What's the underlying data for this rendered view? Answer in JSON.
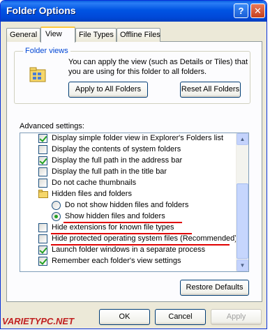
{
  "window": {
    "title": "Folder Options",
    "help_glyph": "?",
    "close_glyph": "✕"
  },
  "tabs": [
    "General",
    "View",
    "File Types",
    "Offline Files"
  ],
  "folder_views": {
    "label": "Folder views",
    "description": "You can apply the view (such as Details or Tiles) that you are using for this folder to all folders.",
    "apply_button": "Apply to All Folders",
    "reset_button": "Reset All Folders"
  },
  "advanced": {
    "label": "Advanced settings:",
    "items": [
      {
        "type": "checkbox",
        "checked": true,
        "label": "Display simple folder view in Explorer's Folders list"
      },
      {
        "type": "checkbox",
        "checked": false,
        "label": "Display the contents of system folders"
      },
      {
        "type": "checkbox",
        "checked": true,
        "label": "Display the full path in the address bar"
      },
      {
        "type": "checkbox",
        "checked": false,
        "label": "Display the full path in the title bar"
      },
      {
        "type": "checkbox",
        "checked": false,
        "label": "Do not cache thumbnails"
      },
      {
        "type": "folder",
        "label": "Hidden files and folders"
      },
      {
        "type": "radio",
        "checked": false,
        "label": "Do not show hidden files and folders"
      },
      {
        "type": "radio",
        "checked": true,
        "label": "Show hidden files and folders"
      },
      {
        "type": "checkbox",
        "checked": false,
        "label": "Hide extensions for known file types"
      },
      {
        "type": "checkbox",
        "checked": false,
        "label": "Hide protected operating system files (Recommended)"
      },
      {
        "type": "checkbox",
        "checked": true,
        "label": "Launch folder windows in a separate process"
      },
      {
        "type": "checkbox",
        "checked": true,
        "label": "Remember each folder's view settings"
      }
    ],
    "restore_button": "Restore Defaults"
  },
  "footer": {
    "ok": "OK",
    "cancel": "Cancel",
    "apply": "Apply"
  },
  "watermark": "VARIETYPC.NET",
  "colors": {
    "title_bar": "#0054e3",
    "highlight_underline": "#e00000",
    "group_label": "#0046d5"
  }
}
